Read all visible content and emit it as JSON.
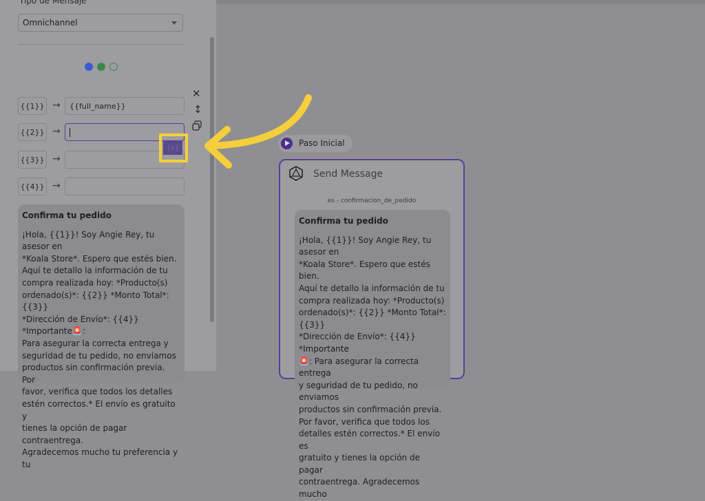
{
  "left_panel": {
    "message_type_label": "Tipo de Mensaje",
    "message_type_value": "Omnichannel",
    "channel_icons": [
      "messenger-icon",
      "whatsapp-icon",
      "sms-icon"
    ],
    "variables": [
      {
        "key": "{{1}}",
        "value": "{{full_name}}"
      },
      {
        "key": "{{2}}",
        "value": ""
      },
      {
        "key": "{{3}}",
        "value": ""
      },
      {
        "key": "{{4}}",
        "value": ""
      }
    ],
    "var_button_label": "{x}",
    "tools": [
      "close-icon",
      "move-vertical-icon",
      "copy-icon"
    ],
    "preview": {
      "title": "Confirma tu pedido",
      "lines": [
        "¡Hola, {{1}}! Soy Angie Rey, tu asesor en",
        "*Koala Store*. Espero que estés bien.",
        "Aquí te detallo la información de tu",
        "compra realizada hoy: *Producto(s)",
        "ordenado(s)*: {{2}} *Monto Total*: {{3}}",
        "*Dirección de Envío*: {{4}} *Importante🚨:",
        "Para asegurar la correcta entrega y",
        "seguridad de tu pedido, no enviamos",
        "productos sin confirmación previa. Por",
        "favor, verifica que todos los detalles",
        "estén correctos.* El envío es gratuito y",
        "tienes la opción de pagar contraentrega.",
        "Agradecemos mucho tu preferencia y tu"
      ]
    }
  },
  "canvas": {
    "start_node_label": "Paso Inicial",
    "card": {
      "title": "Send Message",
      "template_name": "es - confirmacion_de_pedido",
      "preview_title": "Confirma tu pedido",
      "lines": [
        "¡Hola, {{1}}! Soy Angie Rey, tu asesor en",
        "*Koala Store*. Espero que estés bien.",
        "Aquí te detallo la información de tu",
        "compra realizada hoy: *Producto(s)",
        "ordenado(s)*: {{2}} *Monto Total*: {{3}}",
        "*Dirección de Envío*: {{4}} *Importante",
        "🚨: Para asegurar la correcta entrega",
        "y seguridad de tu pedido, no enviamos",
        "productos sin confirmación previa.",
        "Por favor, verifica que todos los",
        "detalles estén correctos.* El envío es",
        "gratuito y tienes la opción de pagar",
        "contraentrega. Agradecemos mucho"
      ]
    }
  },
  "colors": {
    "accent_purple": "#5a3e96",
    "highlight_yellow": "#f5cf3b",
    "overlay_gray": "#8f8f92"
  }
}
